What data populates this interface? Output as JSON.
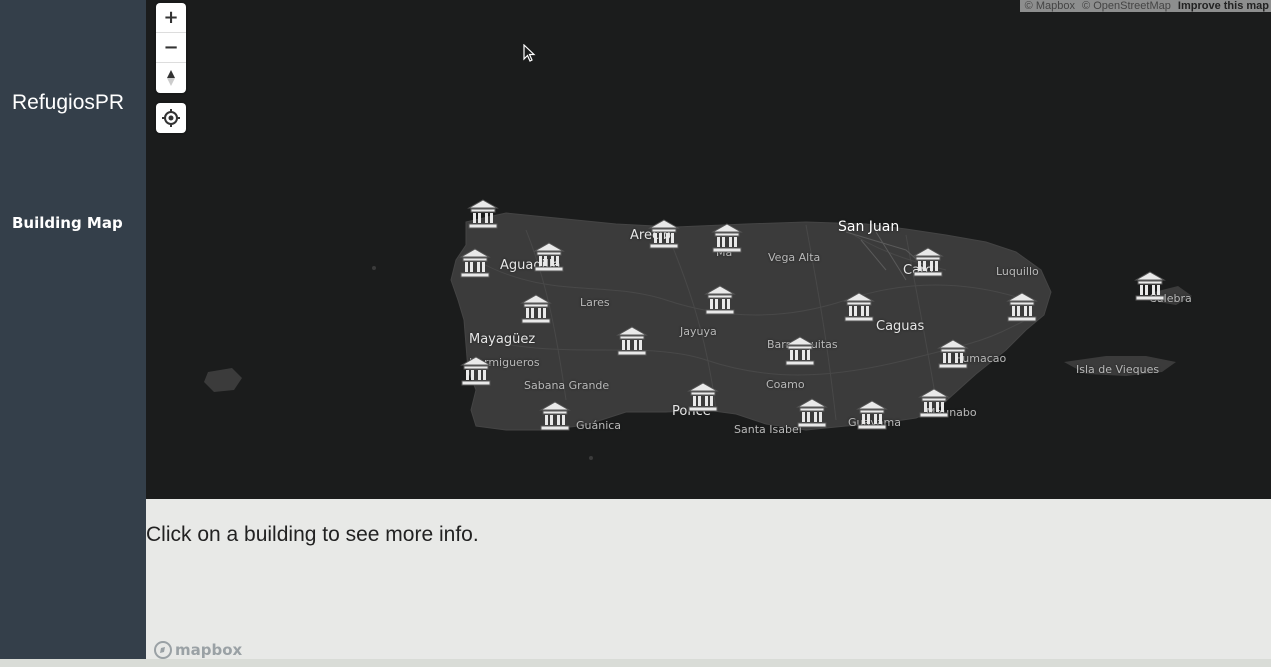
{
  "sidebar": {
    "brand": "RefugiosPR",
    "nav": [
      {
        "label": "Building Map"
      }
    ]
  },
  "map": {
    "attribution": {
      "mapbox": "© Mapbox",
      "osm": "© OpenStreetMap",
      "improve": "Improve this map"
    },
    "controls": {
      "zoom_in": "+",
      "zoom_out": "−",
      "compass": "compass-icon",
      "geolocate": "geolocate-icon"
    },
    "places": [
      {
        "name": "San Juan",
        "size": "major"
      },
      {
        "name": "Arecib",
        "size": "mid"
      },
      {
        "name": "Ma",
        "size": "minor"
      },
      {
        "name": "Vega Alta",
        "size": "minor"
      },
      {
        "name": "Caro",
        "size": "mid"
      },
      {
        "name": "Luquillo",
        "size": "minor"
      },
      {
        "name": "Aguadilla",
        "size": "mid"
      },
      {
        "name": "Lares",
        "size": "minor"
      },
      {
        "name": "Mayagüez",
        "size": "mid"
      },
      {
        "name": "Hormigueros",
        "size": "minor"
      },
      {
        "name": "Jayuya",
        "size": "minor"
      },
      {
        "name": "Barranquitas",
        "size": "minor"
      },
      {
        "name": "Caguas",
        "size": "mid"
      },
      {
        "name": "Humacao",
        "size": "minor"
      },
      {
        "name": "Culebra",
        "size": "minor"
      },
      {
        "name": "Isla de Vieques",
        "size": "minor"
      },
      {
        "name": "Sabana Grande",
        "size": "minor"
      },
      {
        "name": "Coamo",
        "size": "minor"
      },
      {
        "name": "Ponce",
        "size": "mid"
      },
      {
        "name": "Guánica",
        "size": "minor"
      },
      {
        "name": "Santa Isabel",
        "size": "minor"
      },
      {
        "name": "Guayama",
        "size": "minor"
      },
      {
        "name": "Maunabo",
        "size": "minor"
      }
    ],
    "markers": [
      {
        "name": "building-marker",
        "icon": "building-icon"
      }
    ],
    "logo": "mapbox"
  },
  "info": {
    "message": "Click on a building to see more info."
  },
  "colors": {
    "sidebar": "#343f4a",
    "map_water": "#1b1c1c",
    "land": "#3a3a3a",
    "marker": "#e9e9e9",
    "info_bg": "#e8e9e7"
  }
}
